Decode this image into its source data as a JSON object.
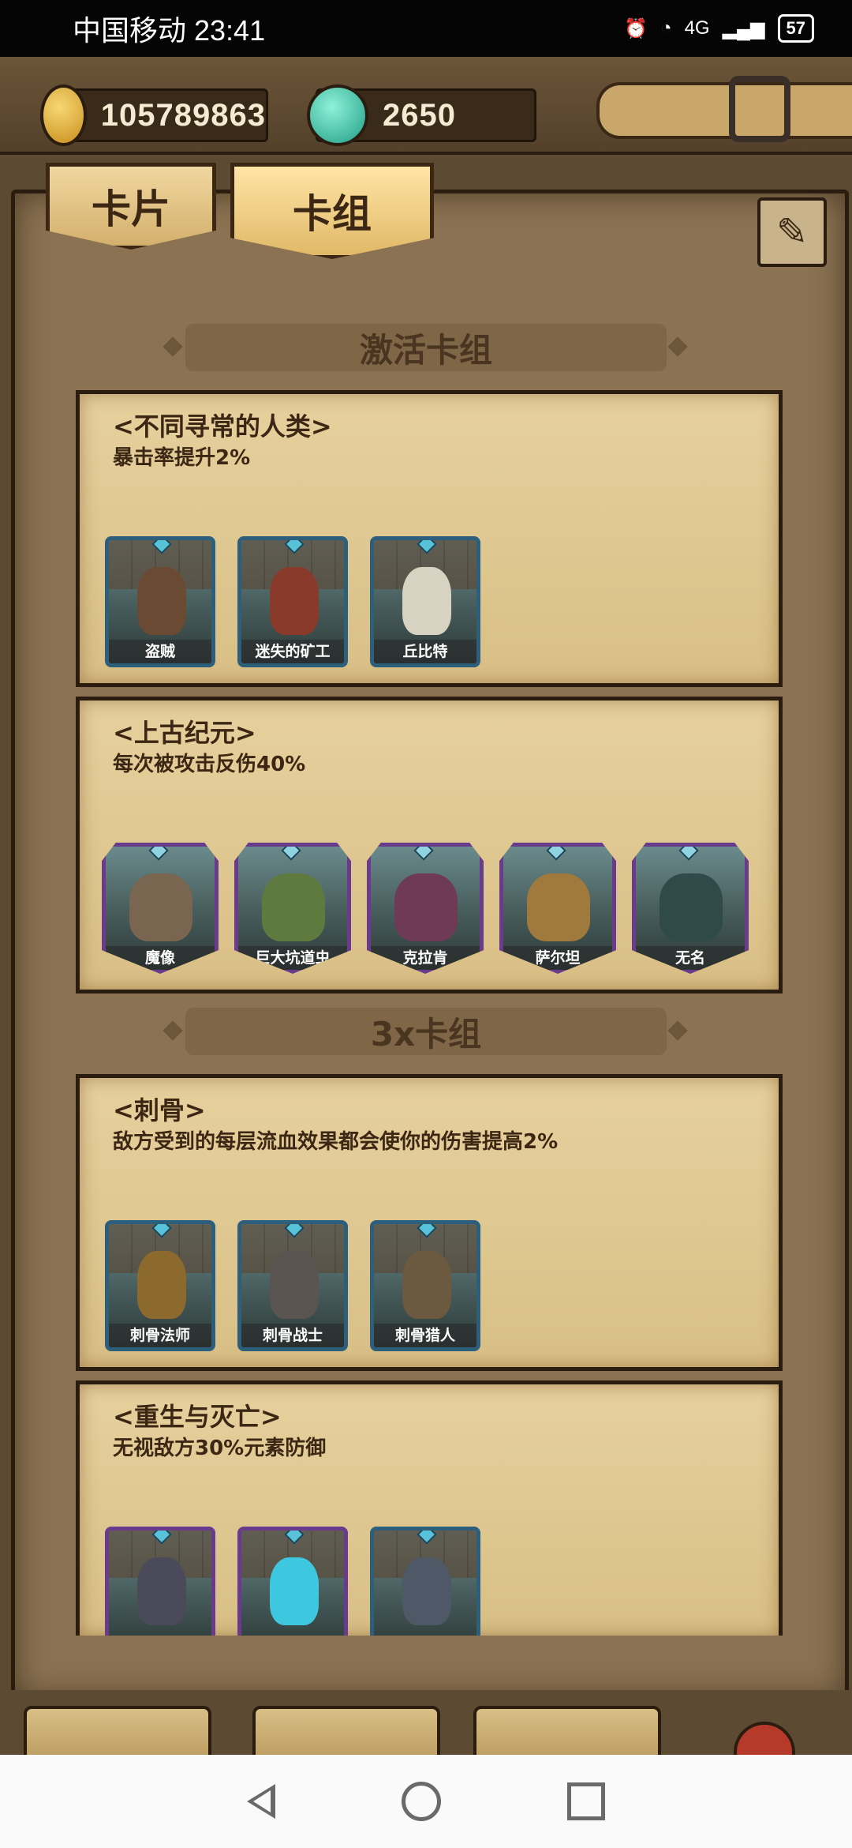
{
  "status_bar": {
    "carrier_time": "中国移动 23:41",
    "network": "4G",
    "battery": "57"
  },
  "currencies": [
    {
      "icon": "gold-nugget-icon",
      "value": "105789863"
    },
    {
      "icon": "diamond-gem-icon",
      "value": "2650"
    }
  ],
  "tabs": [
    {
      "label": "卡片",
      "active": false
    },
    {
      "label": "卡组",
      "active": true
    }
  ],
  "sections": [
    {
      "title": "激活卡组",
      "sets": [
        {
          "name": "<不同寻常的人类>",
          "effect": "暴击率提升2%",
          "cards": [
            "盗贼",
            "迷失的矿工",
            "丘比特"
          ],
          "rarity": "blue"
        },
        {
          "name": "<上古纪元>",
          "effect": "每次被攻击反伤40%",
          "cards": [
            "魔像",
            "巨大坑道虫",
            "克拉肯",
            "萨尔坦",
            "无名"
          ],
          "rarity": "purple"
        }
      ]
    },
    {
      "title": "3x卡组",
      "sets": [
        {
          "name": "<刺骨>",
          "effect": "敌方受到的每层流血效果都会使你的伤害提高2%",
          "cards": [
            "刺骨法师",
            "刺骨战士",
            "刺骨猎人"
          ],
          "rarity": "blue"
        },
        {
          "name": "<重生与灭亡>",
          "effect": "无视敌方30%元素防御",
          "cards": [],
          "rarity": "mixed"
        }
      ]
    }
  ],
  "colors": {
    "parchment": "#e6d09d",
    "frame_dark": "#2a1d10",
    "blue_frame": "#2b5f7c",
    "purple_frame": "#6a3b8c"
  }
}
